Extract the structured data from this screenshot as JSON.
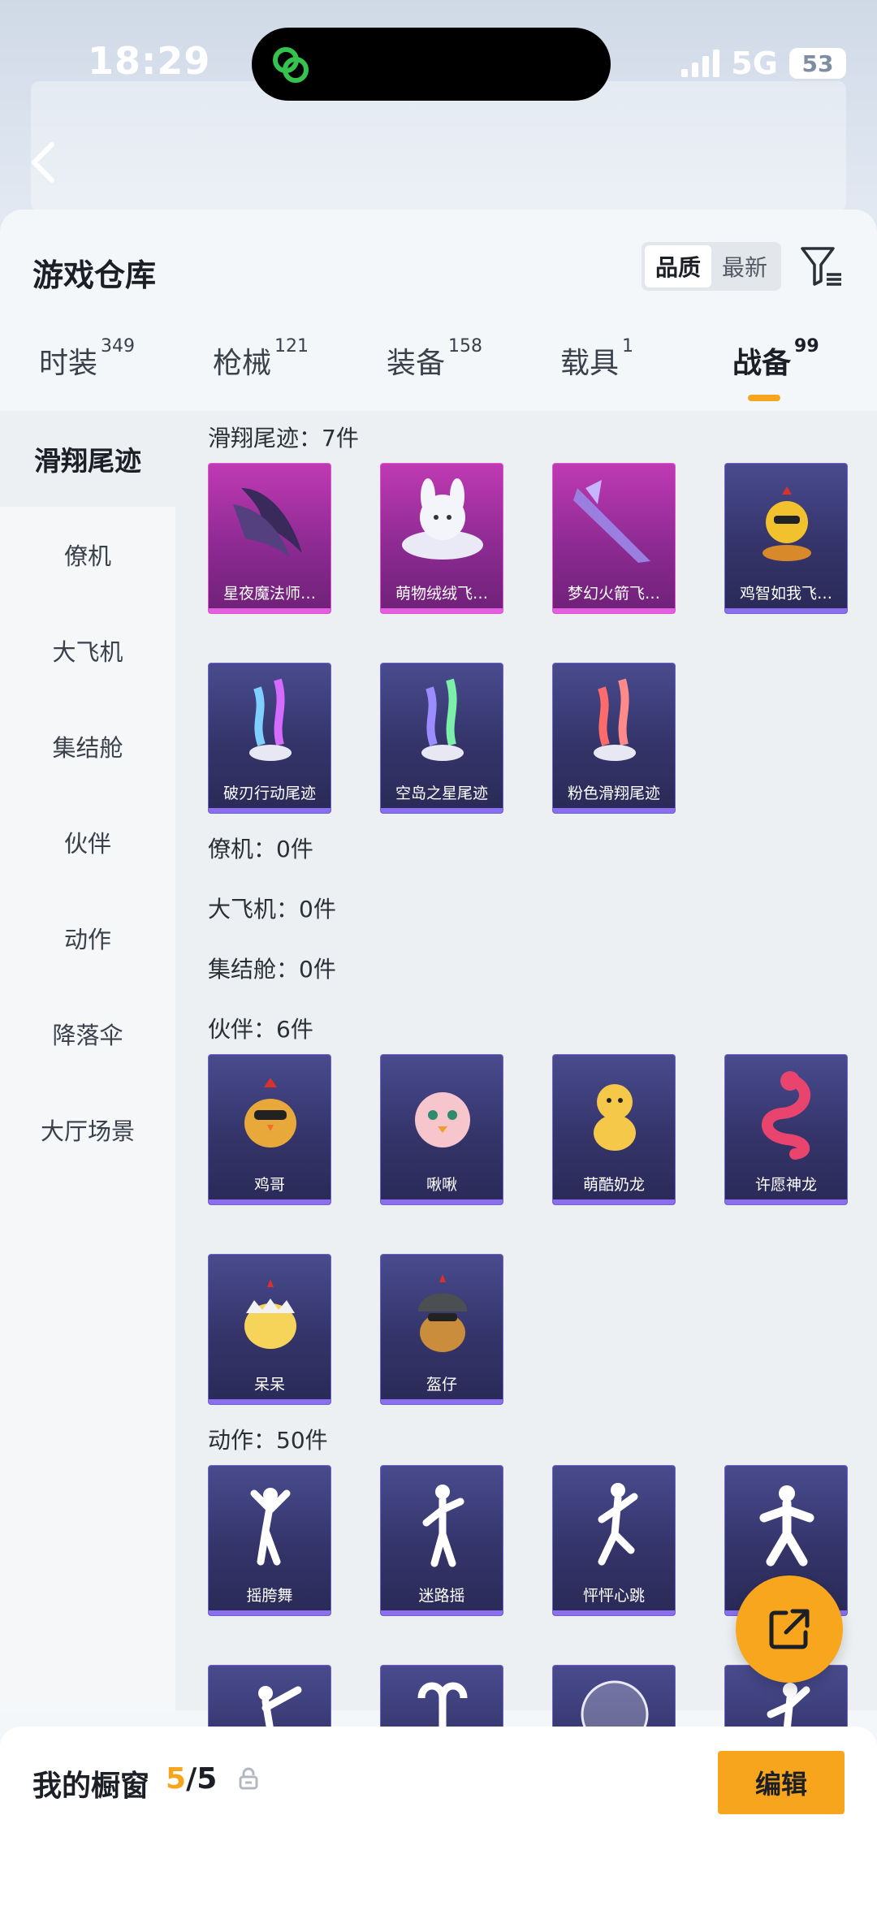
{
  "status_bar": {
    "time": "18:29",
    "network": "5G",
    "battery": "53"
  },
  "header": {
    "title": "游戏仓库",
    "sort_options": [
      "品质",
      "最新"
    ],
    "active_sort": "品质"
  },
  "tabs": [
    {
      "label": "时装",
      "count": "349"
    },
    {
      "label": "枪械",
      "count": "121"
    },
    {
      "label": "装备",
      "count": "158"
    },
    {
      "label": "载具",
      "count": "1"
    },
    {
      "label": "战备",
      "count": "99"
    }
  ],
  "active_tab": "战备",
  "sidebar": {
    "items": [
      "滑翔尾迹",
      "僚机",
      "大飞机",
      "集结舱",
      "伙伴",
      "动作",
      "降落伞",
      "大厅场景"
    ],
    "active": "滑翔尾迹"
  },
  "sections": {
    "glide": {
      "label": "滑翔尾迹：7件",
      "items": [
        "星夜魔法师…",
        "萌物绒绒飞…",
        "梦幻火箭飞…",
        "鸡智如我飞…",
        "破刃行动尾迹",
        "空岛之星尾迹",
        "粉色滑翔尾迹"
      ]
    },
    "wingman": {
      "label": "僚机：0件"
    },
    "plane": {
      "label": "大飞机：0件"
    },
    "pod": {
      "label": "集结舱：0件"
    },
    "partner": {
      "label": "伙伴：6件",
      "items": [
        "鸡哥",
        "啾啾",
        "萌酷奶龙",
        "许愿神龙",
        "呆呆",
        "盔仔"
      ]
    },
    "emote": {
      "label": "动作：50件",
      "items": [
        "摇胯舞",
        "迷路摇",
        "怦怦心跳",
        "",
        "",
        "",
        "",
        ""
      ]
    }
  },
  "showcase": {
    "title": "我的橱窗",
    "current": "5",
    "total": "/5",
    "edit_label": "编辑"
  },
  "colors": {
    "accent": "#f7a51d",
    "purple_rarity": "#c23bb5",
    "blue_rarity": "#3a3a74"
  }
}
